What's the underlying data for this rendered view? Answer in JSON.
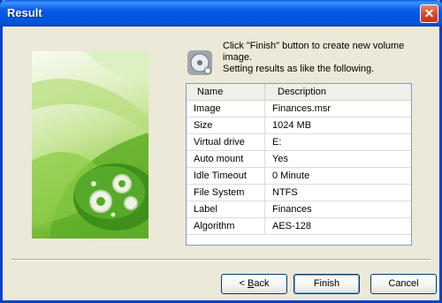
{
  "window": {
    "title": "Result"
  },
  "info": {
    "line1": "Click \"Finish\" button to create new volume image.",
    "line2": "Setting results as like the following."
  },
  "grid": {
    "headers": [
      "Name",
      "Description"
    ],
    "rows": [
      {
        "name": "Image",
        "value": "Finances.msr"
      },
      {
        "name": "Size",
        "value": "1024 MB"
      },
      {
        "name": "Virtual drive",
        "value": "E:"
      },
      {
        "name": "Auto mount",
        "value": "Yes"
      },
      {
        "name": "Idle Timeout",
        "value": "0 Minute"
      },
      {
        "name": "File System",
        "value": "NTFS"
      },
      {
        "name": "Label",
        "value": "Finances"
      },
      {
        "name": "Algorithm",
        "value": "AES-128"
      }
    ]
  },
  "buttons": {
    "back_underlined": "B",
    "back_rest": "ack",
    "back_prefix": "< ",
    "finish": "Finish",
    "cancel": "Cancel"
  },
  "icons": {
    "close": "close-icon",
    "info": "disk-icon",
    "art": "leaf-gear-illustration"
  },
  "colors": {
    "titlebar": "#0054e3",
    "close_button": "#d4452a",
    "dialog_bg": "#ece9d8"
  }
}
